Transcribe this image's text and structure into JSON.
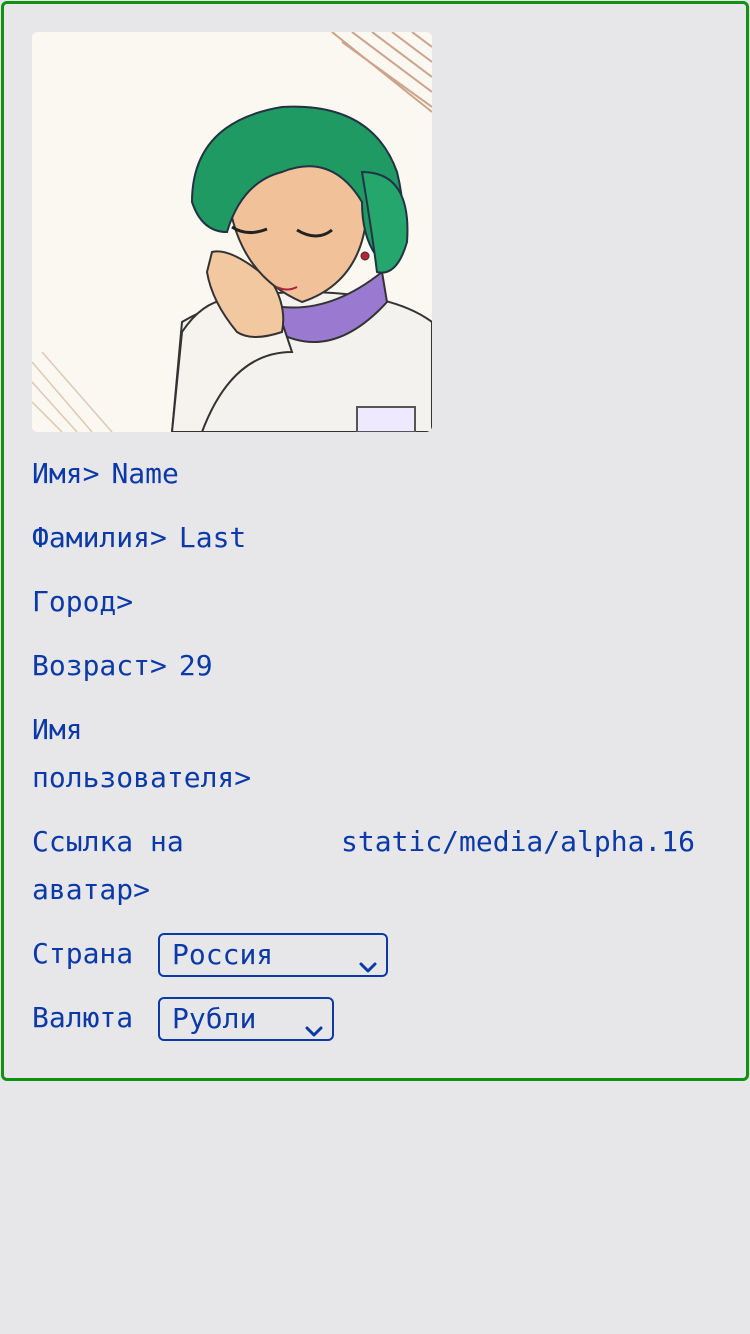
{
  "profile": {
    "avatar_alt": "avatar-image",
    "fields": {
      "first_name": {
        "label": "Имя>",
        "value": "Name"
      },
      "last_name": {
        "label": "Фамилия>",
        "value": "Last"
      },
      "city": {
        "label": "Город>",
        "value": ""
      },
      "age": {
        "label": "Возраст>",
        "value": "29"
      },
      "username": {
        "label": "Имя пользователя>",
        "value": ""
      },
      "avatar_link": {
        "label": "Ссылка на аватар>",
        "value": "static/media/alpha.16"
      }
    },
    "country": {
      "label": "Страна",
      "selected": "Россия"
    },
    "currency": {
      "label": "Валюта",
      "selected": "Рубли"
    }
  },
  "colors": {
    "text": "#0b3aa8",
    "border": "#119111",
    "background": "#e7e7ea"
  },
  "icons": {
    "select_arrow": "chevron-down-icon"
  }
}
